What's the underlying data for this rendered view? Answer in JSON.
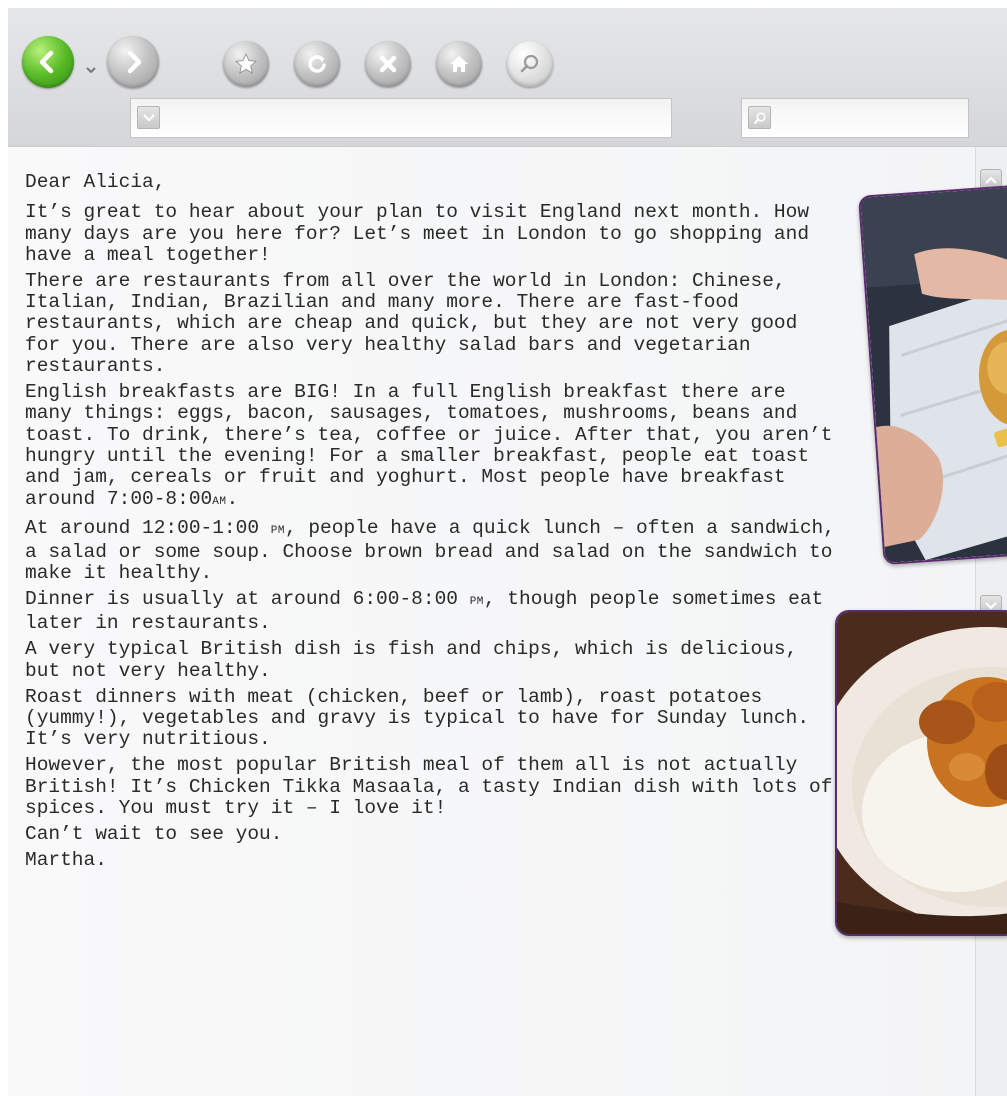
{
  "toolbar": {
    "address": {
      "value": ""
    },
    "search": {
      "value": ""
    }
  },
  "letter": {
    "greeting": "Dear Alicia,",
    "p1": "It’s great to hear about your plan to visit England next month. How many days are you here for? Let’s meet in London to go shopping and have a meal together!",
    "p2": "There are restaurants from all over the world in London: Chinese, Italian, Indian, Brazilian and many more. There are fast-food restaurants, which are cheap and quick, but they are not very good for you. There are also very healthy salad bars and vegetarian restaurants.",
    "p3_text": "English breakfasts are BIG! In a full English breakfast there are many things: eggs, bacon, sausages, tomatoes, mushrooms, beans and toast. To drink, there’s tea, coffee or juice. After that, you aren’t hungry until the evening! For a smaller breakfast, people eat toast and jam, cereals or fruit and yoghurt. Most people have breakfast around 7:00-8:00",
    "p3_am": "AM",
    "p3_end": ".",
    "p4_a": "At around 12:00-1:00 ",
    "p4_pm": "PM",
    "p4_b": ", people have a quick lunch – often a sandwich, a salad or some soup. Choose brown bread and salad on the sandwich to make it healthy.",
    "p5_a": "Dinner is usually at around 6:00-8:00 ",
    "p5_pm": "PM",
    "p5_b": ", though people sometimes eat later in restaurants.",
    "p6": "A very typical British dish is fish and chips, which is delicious, but not very healthy.",
    "p7": "Roast dinners with meat (chicken, beef or lamb), roast potatoes (yummy!), vegetables and gravy is typical to have for Sunday lunch. It’s very nutritious.",
    "p8": "However, the most popular British meal of them all is not actually British! It’s Chicken Tikka Masaala, a tasty Indian dish with lots of spices. You must try it – I love it!",
    "closing": "Can’t wait to see you.",
    "signature": "Martha."
  },
  "colors": {
    "back_button": "#58bb27",
    "photo_frame": "#5a2a6e",
    "toolbar_bg": "#dcdddf"
  },
  "icons": [
    "back-arrow-icon",
    "chevron-down-icon",
    "forward-arrow-icon",
    "star-icon",
    "refresh-icon",
    "close-icon",
    "home-icon",
    "search-icon"
  ]
}
